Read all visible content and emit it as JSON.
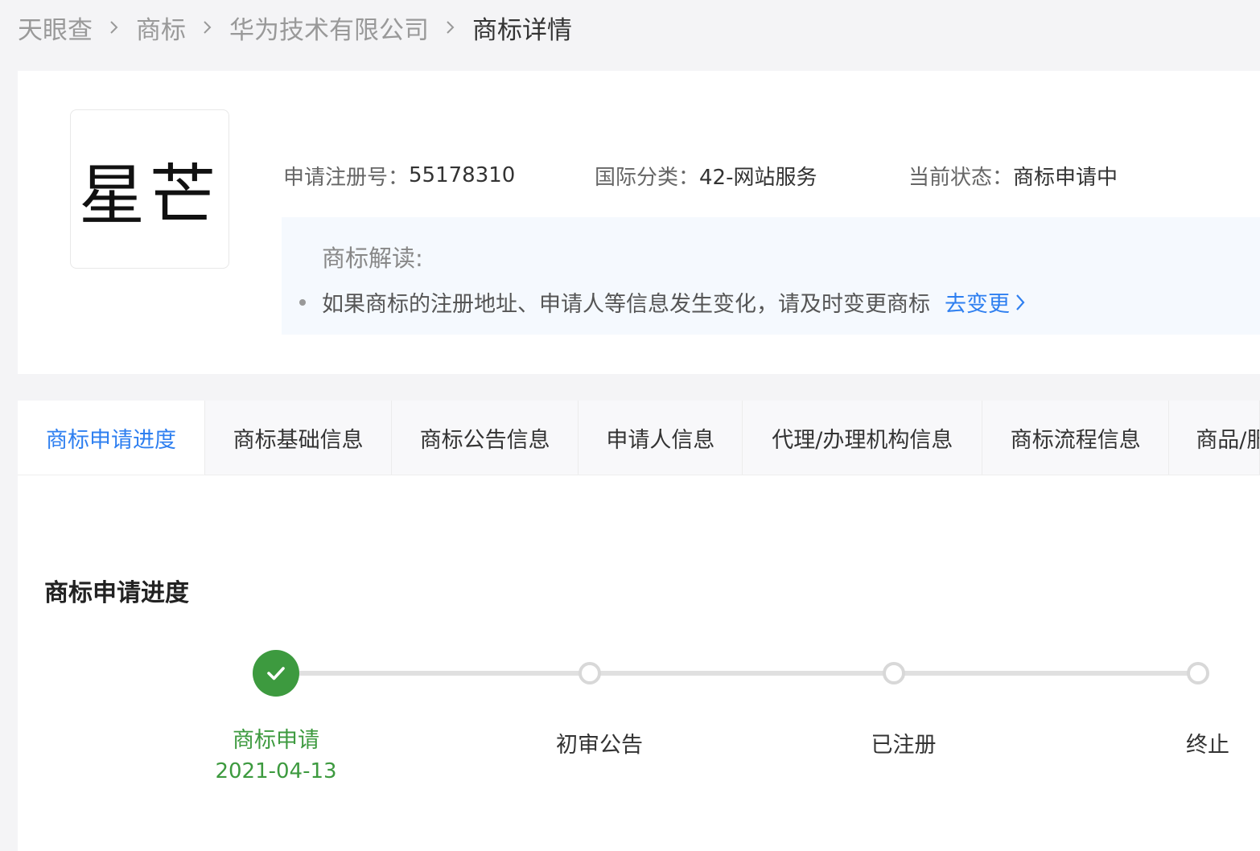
{
  "breadcrumb": {
    "items": [
      "天眼查",
      "商标",
      "华为技术有限公司",
      "商标详情"
    ]
  },
  "trademark": {
    "image_text": "星芒",
    "reg_no_label": "申请注册号：",
    "reg_no": "55178310",
    "class_label": "国际分类：",
    "class_value": "42-网站服务",
    "status_label": "当前状态：",
    "status_value": "商标申请中"
  },
  "reading": {
    "title": "商标解读:",
    "item_text": "如果商标的注册地址、申请人等信息发生变化，请及时变更商标",
    "link_text": "去变更"
  },
  "tabs": [
    {
      "label": "商标申请进度",
      "active": true
    },
    {
      "label": "商标基础信息",
      "active": false
    },
    {
      "label": "商标公告信息",
      "active": false
    },
    {
      "label": "申请人信息",
      "active": false
    },
    {
      "label": "代理/办理机构信息",
      "active": false
    },
    {
      "label": "商标流程信息",
      "active": false
    },
    {
      "label": "商品/服务项目",
      "active": false
    }
  ],
  "progress": {
    "title": "商标申请进度",
    "steps": [
      {
        "label": "商标申请",
        "date": "2021-04-13",
        "done": true
      },
      {
        "label": "初审公告",
        "date": "",
        "done": false
      },
      {
        "label": "已注册",
        "date": "",
        "done": false
      },
      {
        "label": "终止",
        "date": "",
        "done": false
      }
    ]
  },
  "colors": {
    "accent": "#2e7ff0",
    "success": "#3d9a3f"
  },
  "icons": {
    "breadcrumb_separator": "chevron-right-icon",
    "link_arrow": "chevron-right-icon",
    "step_done": "check-icon"
  }
}
